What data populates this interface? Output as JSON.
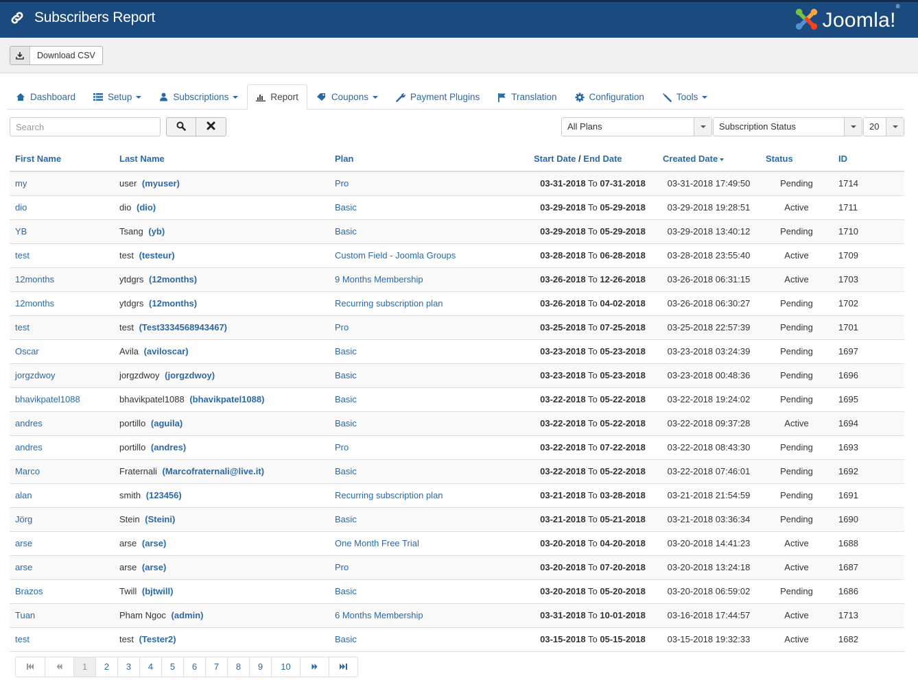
{
  "header": {
    "title": "Subscribers Report",
    "logo_text": "Joomla!",
    "logo_mark": "®",
    "brand_color": "#1a4a7e"
  },
  "toolbar": {
    "download_label": "Download CSV"
  },
  "nav": {
    "items": [
      {
        "label": "Dashboard",
        "icon": "home-icon",
        "dropdown": false,
        "active": false
      },
      {
        "label": "Setup",
        "icon": "list-icon",
        "dropdown": true,
        "active": false
      },
      {
        "label": "Subscriptions",
        "icon": "user-icon",
        "dropdown": true,
        "active": false
      },
      {
        "label": "Report",
        "icon": "bar-chart-icon",
        "dropdown": false,
        "active": true
      },
      {
        "label": "Coupons",
        "icon": "tag-icon",
        "dropdown": true,
        "active": false
      },
      {
        "label": "Payment Plugins",
        "icon": "wrench-icon",
        "dropdown": false,
        "active": false
      },
      {
        "label": "Translation",
        "icon": "flag-icon",
        "dropdown": false,
        "active": false
      },
      {
        "label": "Configuration",
        "icon": "gear-icon",
        "dropdown": false,
        "active": false
      },
      {
        "label": "Tools",
        "icon": "screwdriver-icon",
        "dropdown": true,
        "active": false
      }
    ]
  },
  "filters": {
    "search_placeholder": "Search",
    "search_value": "",
    "plan_select": "All Plans",
    "status_select": "Subscription Status",
    "limit_select": "20"
  },
  "table": {
    "columns": {
      "first_name": "First Name",
      "last_name": "Last Name",
      "plan": "Plan",
      "start_date": "Start Date",
      "date_sep": "/",
      "end_date": "End Date",
      "created_date": "Created Date",
      "status": "Status",
      "id": "ID"
    },
    "date_joiner": "To",
    "rows": [
      {
        "first_name": "my",
        "last_name": "user",
        "username": "(myuser)",
        "plan": "Pro",
        "start": "03-31-2018",
        "end": "07-31-2018",
        "created": "03-31-2018 17:49:50",
        "status": "Pending",
        "id": "1714"
      },
      {
        "first_name": "dio",
        "last_name": "dio",
        "username": "(dio)",
        "plan": "Basic",
        "start": "03-29-2018",
        "end": "05-29-2018",
        "created": "03-29-2018 19:28:51",
        "status": "Active",
        "id": "1711"
      },
      {
        "first_name": "YB",
        "last_name": "Tsang",
        "username": "(yb)",
        "plan": "Basic",
        "start": "03-29-2018",
        "end": "05-29-2018",
        "created": "03-29-2018 13:40:12",
        "status": "Pending",
        "id": "1710"
      },
      {
        "first_name": "test",
        "last_name": "test",
        "username": "(testeur)",
        "plan": "Custom Field - Joomla Groups",
        "start": "03-28-2018",
        "end": "06-28-2018",
        "created": "03-28-2018 23:55:40",
        "status": "Active",
        "id": "1709"
      },
      {
        "first_name": "12months",
        "last_name": "ytdgrs",
        "username": "(12months)",
        "plan": "9 Months Membership",
        "start": "03-26-2018",
        "end": "12-26-2018",
        "created": "03-26-2018 06:31:15",
        "status": "Active",
        "id": "1703"
      },
      {
        "first_name": "12months",
        "last_name": "ytdgrs",
        "username": "(12months)",
        "plan": "Recurring subscription plan",
        "start": "03-26-2018",
        "end": "04-02-2018",
        "created": "03-26-2018 06:30:27",
        "status": "Pending",
        "id": "1702"
      },
      {
        "first_name": "test",
        "last_name": "test",
        "username": "(Test3334568943467)",
        "plan": "Pro",
        "start": "03-25-2018",
        "end": "07-25-2018",
        "created": "03-25-2018 22:57:39",
        "status": "Pending",
        "id": "1701"
      },
      {
        "first_name": "Oscar",
        "last_name": "Avila",
        "username": "(aviloscar)",
        "plan": "Basic",
        "start": "03-23-2018",
        "end": "05-23-2018",
        "created": "03-23-2018 03:24:39",
        "status": "Pending",
        "id": "1697"
      },
      {
        "first_name": "jorgzdwoy",
        "last_name": "jorgzdwoy",
        "username": "(jorgzdwoy)",
        "plan": "Basic",
        "start": "03-23-2018",
        "end": "05-23-2018",
        "created": "03-23-2018 00:48:36",
        "status": "Pending",
        "id": "1696"
      },
      {
        "first_name": "bhavikpatel1088",
        "last_name": "bhavikpatel1088",
        "username": "(bhavikpatel1088)",
        "plan": "Basic",
        "start": "03-22-2018",
        "end": "05-22-2018",
        "created": "03-22-2018 19:24:02",
        "status": "Pending",
        "id": "1695"
      },
      {
        "first_name": "andres",
        "last_name": "portillo",
        "username": "(aguila)",
        "plan": "Basic",
        "start": "03-22-2018",
        "end": "05-22-2018",
        "created": "03-22-2018 09:37:28",
        "status": "Active",
        "id": "1694"
      },
      {
        "first_name": "andres",
        "last_name": "portillo",
        "username": "(andres)",
        "plan": "Pro",
        "start": "03-22-2018",
        "end": "07-22-2018",
        "created": "03-22-2018 08:43:30",
        "status": "Pending",
        "id": "1693"
      },
      {
        "first_name": "Marco",
        "last_name": "Fraternali",
        "username": "(Marcofraternali@live.it)",
        "plan": "Basic",
        "start": "03-22-2018",
        "end": "05-22-2018",
        "created": "03-22-2018 07:46:01",
        "status": "Pending",
        "id": "1692"
      },
      {
        "first_name": "alan",
        "last_name": "smith",
        "username": "(123456)",
        "plan": "Recurring subscription plan",
        "start": "03-21-2018",
        "end": "03-28-2018",
        "created": "03-21-2018 21:54:59",
        "status": "Pending",
        "id": "1691"
      },
      {
        "first_name": "Jörg",
        "last_name": "Stein",
        "username": "(Steini)",
        "plan": "Basic",
        "start": "03-21-2018",
        "end": "05-21-2018",
        "created": "03-21-2018 03:36:34",
        "status": "Pending",
        "id": "1690"
      },
      {
        "first_name": "arse",
        "last_name": "arse",
        "username": "(arse)",
        "plan": "One Month Free Trial",
        "start": "03-20-2018",
        "end": "04-20-2018",
        "created": "03-20-2018 14:41:23",
        "status": "Active",
        "id": "1688"
      },
      {
        "first_name": "arse",
        "last_name": "arse",
        "username": "(arse)",
        "plan": "Pro",
        "start": "03-20-2018",
        "end": "07-20-2018",
        "created": "03-20-2018 13:24:18",
        "status": "Active",
        "id": "1687"
      },
      {
        "first_name": "Brazos",
        "last_name": "Twill",
        "username": "(bjtwill)",
        "plan": "Basic",
        "start": "03-20-2018",
        "end": "05-20-2018",
        "created": "03-20-2018 06:59:02",
        "status": "Pending",
        "id": "1686"
      },
      {
        "first_name": "Tuan",
        "last_name": "Pham Ngoc",
        "username": "(admin)",
        "plan": "6 Months Membership",
        "start": "03-31-2018",
        "end": "10-01-2018",
        "created": "03-16-2018 17:44:57",
        "status": "Active",
        "id": "1713"
      },
      {
        "first_name": "test",
        "last_name": "test",
        "username": "(Tester2)",
        "plan": "Basic",
        "start": "03-15-2018",
        "end": "05-15-2018",
        "created": "03-15-2018 19:32:33",
        "status": "Active",
        "id": "1682"
      }
    ]
  },
  "pagination": {
    "first": "first-page-icon",
    "prev": "previous-page-icon",
    "pages": [
      "1",
      "2",
      "3",
      "4",
      "5",
      "6",
      "7",
      "8",
      "9",
      "10"
    ],
    "current": "1",
    "next": "next-page-icon",
    "last": "last-page-icon"
  }
}
